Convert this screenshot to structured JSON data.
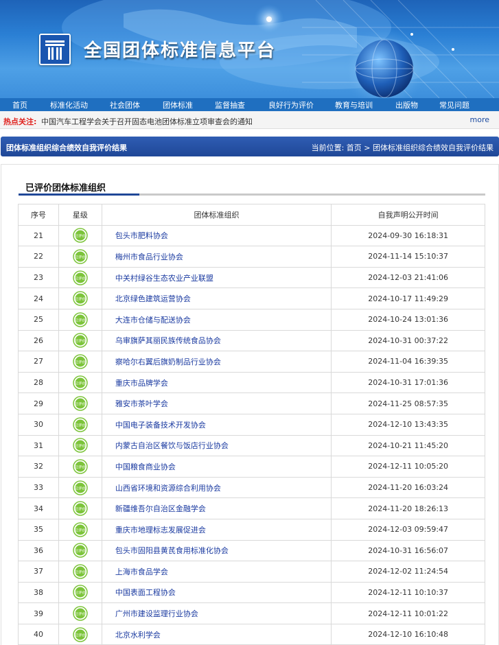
{
  "site": {
    "title": "全国团体标准信息平台"
  },
  "nav": [
    "首页",
    "标准化活动",
    "社会团体",
    "团体标准",
    "监督抽查",
    "良好行为评价",
    "教育与培训",
    "出版物",
    "常见问题"
  ],
  "hot": {
    "label": "热点关注:",
    "text": "中国汽车工程学会关于召开固态电池团体标准立项审查会的通知",
    "more": "more"
  },
  "page": {
    "title": "团体标准组织综合绩效自我评价结果",
    "breadcrumb": "当前位置:  首页 > 团体标准组织综合绩效自我评价结果"
  },
  "section": {
    "title": "已评价团体标准组织"
  },
  "table": {
    "headers": [
      "序号",
      "星级",
      "团体标准组织",
      "自我声明公开时间"
    ],
    "badge_text": "已评价",
    "badge_color": "#7cc43a",
    "rows": [
      {
        "no": "21",
        "org": "包头市肥料协会",
        "time": "2024-09-30 16:18:31"
      },
      {
        "no": "22",
        "org": "梅州市食品行业协会",
        "time": "2024-11-14 15:10:37"
      },
      {
        "no": "23",
        "org": "中关村绿谷生态农业产业联盟",
        "time": "2024-12-03 21:41:06"
      },
      {
        "no": "24",
        "org": "北京绿色建筑运营协会",
        "time": "2024-10-17 11:49:29"
      },
      {
        "no": "25",
        "org": "大连市仓储与配送协会",
        "time": "2024-10-24 13:01:36"
      },
      {
        "no": "26",
        "org": "乌审旗萨其丽民族传统食品协会",
        "time": "2024-10-31 00:37:22"
      },
      {
        "no": "27",
        "org": "察哈尔右翼后旗奶制品行业协会",
        "time": "2024-11-04 16:39:35"
      },
      {
        "no": "28",
        "org": "重庆市品牌学会",
        "time": "2024-10-31 17:01:36"
      },
      {
        "no": "29",
        "org": "雅安市茶叶学会",
        "time": "2024-11-25 08:57:35"
      },
      {
        "no": "30",
        "org": "中国电子装备技术开发协会",
        "time": "2024-12-10 13:43:35"
      },
      {
        "no": "31",
        "org": "内蒙古自治区餐饮与饭店行业协会",
        "time": "2024-10-21 11:45:20"
      },
      {
        "no": "32",
        "org": "中国粮食商业协会",
        "time": "2024-12-11 10:05:20"
      },
      {
        "no": "33",
        "org": "山西省环境和资源综合利用协会",
        "time": "2024-11-20 16:03:24"
      },
      {
        "no": "34",
        "org": "新疆维吾尔自治区金融学会",
        "time": "2024-11-20 18:26:13"
      },
      {
        "no": "35",
        "org": "重庆市地理标志发展促进会",
        "time": "2024-12-03 09:59:47"
      },
      {
        "no": "36",
        "org": "包头市固阳县黄芪食用标准化协会",
        "time": "2024-10-31 16:56:07"
      },
      {
        "no": "37",
        "org": "上海市食品学会",
        "time": "2024-12-02 11:24:54"
      },
      {
        "no": "38",
        "org": "中国表面工程协会",
        "time": "2024-12-11 10:10:37"
      },
      {
        "no": "39",
        "org": "广州市建设监理行业协会",
        "time": "2024-12-11 10:01:22"
      },
      {
        "no": "40",
        "org": "北京水利学会",
        "time": "2024-12-10 16:10:48"
      }
    ]
  }
}
